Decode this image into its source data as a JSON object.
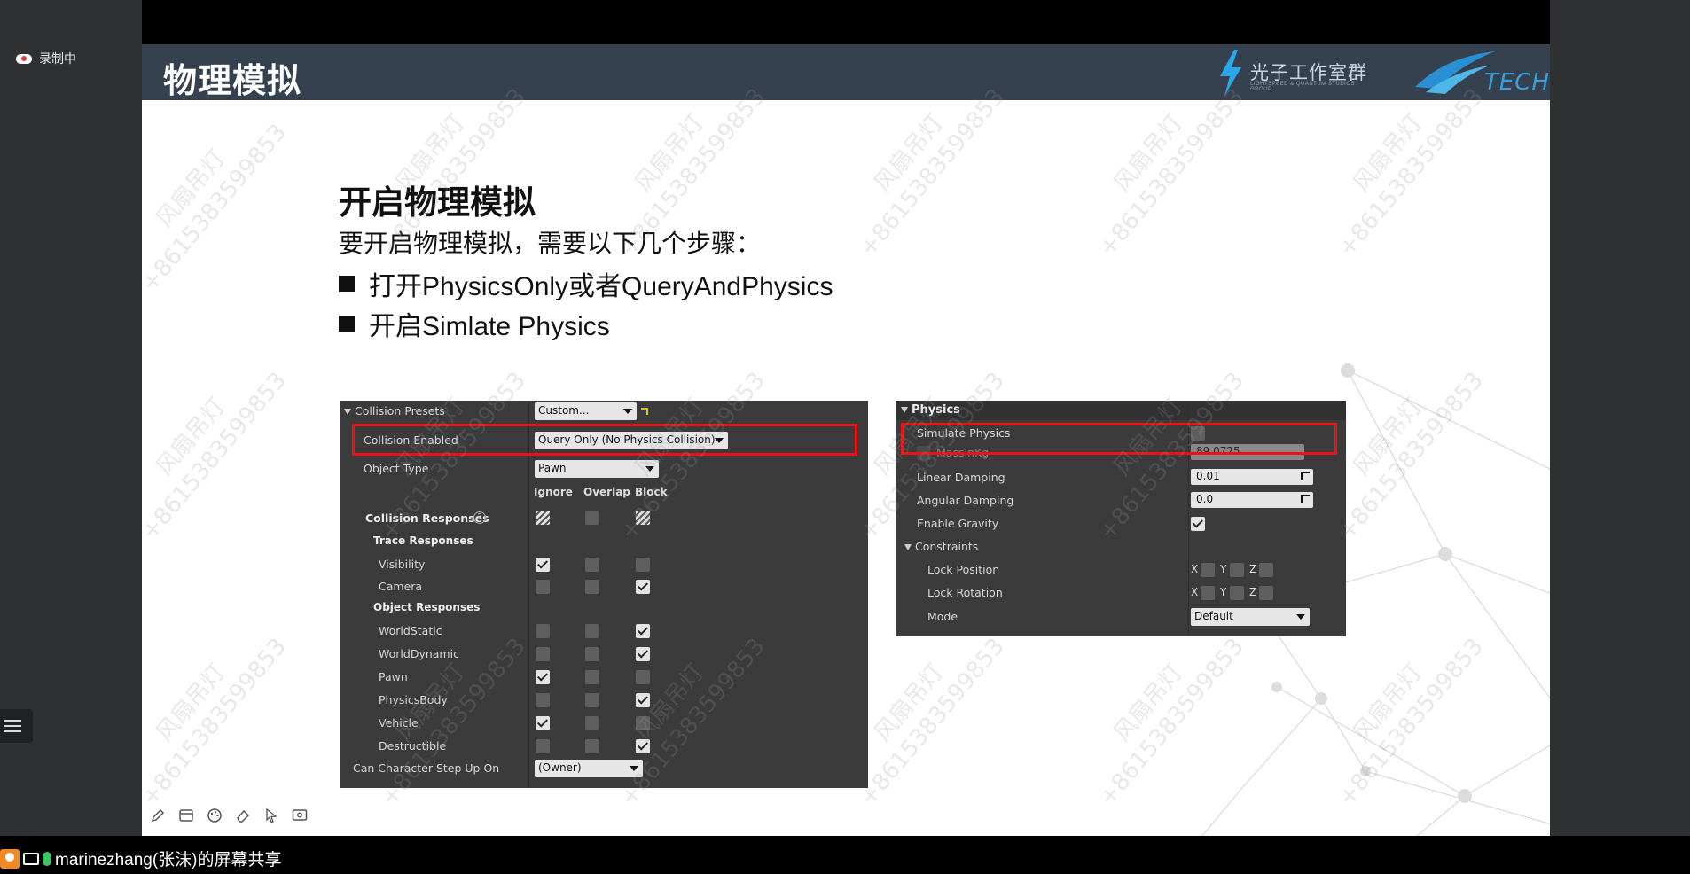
{
  "meeting": {
    "recording_label": "录制中",
    "share_label": "marinezhang(张沫)的屏幕共享"
  },
  "slide": {
    "header_title": "物理模拟",
    "brand_name": "光子工作室群",
    "brand_subtitle": "LIGHTSPEED & QUANTUM STUDIOS GROUP",
    "tech_logo_text": "TECH",
    "content_title": "开启物理模拟",
    "intro": "要开启物理模拟，需要以下几个步骤：",
    "bullets": [
      "打开PhysicsOnly或者QueryAndPhysics",
      "开启Simlate Physics"
    ],
    "watermark_line1": "风扇吊灯",
    "watermark_line2": "+8615383599853"
  },
  "collision_panel": {
    "presets_label": "Collision Presets",
    "presets_value": "Custom...",
    "enabled_label": "Collision Enabled",
    "enabled_value": "Query Only (No Physics Collision)",
    "object_type_label": "Object Type",
    "object_type_value": "Pawn",
    "col_ignore": "Ignore",
    "col_overlap": "Overlap",
    "col_block": "Block",
    "responses_label": "Collision Responses",
    "trace_label": "Trace Responses",
    "object_label": "Object Responses",
    "rows": [
      {
        "label": "Visibility",
        "state": "ignore"
      },
      {
        "label": "Camera",
        "state": "block"
      },
      {
        "label": "WorldStatic",
        "state": "block"
      },
      {
        "label": "WorldDynamic",
        "state": "block"
      },
      {
        "label": "Pawn",
        "state": "ignore"
      },
      {
        "label": "PhysicsBody",
        "state": "block"
      },
      {
        "label": "Vehicle",
        "state": "ignore"
      },
      {
        "label": "Destructible",
        "state": "block"
      }
    ],
    "step_up_label": "Can Character Step Up On",
    "step_up_value": "(Owner)"
  },
  "physics_panel": {
    "header": "Physics",
    "simulate_label": "Simulate Physics",
    "mass_label": "MassInKg",
    "mass_value": "89.0725",
    "linear_label": "Linear Damping",
    "linear_value": "0.01",
    "angular_label": "Angular Damping",
    "angular_value": "0.0",
    "gravity_label": "Enable Gravity",
    "constraints_label": "Constraints",
    "lock_pos_label": "Lock Position",
    "lock_rot_label": "Lock Rotation",
    "axis_x": "X",
    "axis_y": "Y",
    "axis_z": "Z",
    "mode_label": "Mode",
    "mode_value": "Default"
  },
  "colors": {
    "header_bg": "#36414f",
    "highlight": "#e11111",
    "panel_bg": "#3b3b3b"
  }
}
